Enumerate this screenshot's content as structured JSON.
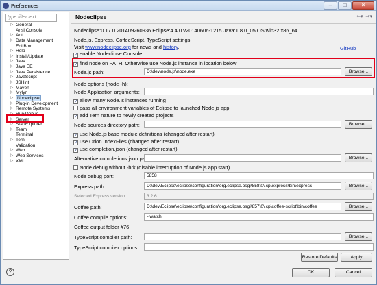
{
  "window": {
    "title": "Preferences"
  },
  "filter": {
    "placeholder": "type filter text"
  },
  "tree": [
    {
      "label": "General",
      "arrow": true
    },
    {
      "label": "Ansi Console",
      "arrow": false
    },
    {
      "label": "Ant",
      "arrow": true
    },
    {
      "label": "Data Management",
      "arrow": true
    },
    {
      "label": "EditBox",
      "arrow": false
    },
    {
      "label": "Help",
      "arrow": true
    },
    {
      "label": "Install/Update",
      "arrow": true
    },
    {
      "label": "Java",
      "arrow": true
    },
    {
      "label": "Java EE",
      "arrow": true
    },
    {
      "label": "Java Persistence",
      "arrow": true
    },
    {
      "label": "JavaScript",
      "arrow": true
    },
    {
      "label": "JSHint",
      "arrow": true
    },
    {
      "label": "Maven",
      "arrow": true
    },
    {
      "label": "Mylyn",
      "arrow": true
    },
    {
      "label": "Nodeclipse",
      "arrow": true,
      "selected": true
    },
    {
      "label": "Plug-in Development",
      "arrow": true
    },
    {
      "label": "Remote Systems",
      "arrow": true
    },
    {
      "label": "Run/Debug",
      "arrow": true
    },
    {
      "label": "Server",
      "arrow": true
    },
    {
      "label": "StartExplorer",
      "arrow": true
    },
    {
      "label": "Team",
      "arrow": true
    },
    {
      "label": "Terminal",
      "arrow": false
    },
    {
      "label": "Tern",
      "arrow": true
    },
    {
      "label": "Validation",
      "arrow": false
    },
    {
      "label": "Web",
      "arrow": true
    },
    {
      "label": "Web Services",
      "arrow": true
    },
    {
      "label": "XML",
      "arrow": true
    }
  ],
  "page": {
    "title": "Nodeclipse",
    "version_line": "Nodeclipse:0.17.0.201409260936 Eclipse:4.4.0.v20140606-1215 Java:1.8.0_05 OS:win32,x86_64",
    "settings_heading": "Node.js, Express, CoffeeScript, TypeScript settings",
    "visit_prefix": "Visit",
    "visit_link": "www.nodeclipse.org",
    "visit_mid": "for news",
    "visit_and": "and",
    "history_link": "history",
    "visit_suffix": ".",
    "github_link": "GitHub",
    "enable_console": "enable Nodeclipse Console",
    "find_node": "find node on PATH. Otherwise use Node.js instance in location below",
    "node_path_label": "Node.js path:",
    "node_path_value": "D:\\dev\\node.js\\node.exe",
    "node_options_label": "Node options (node -h):",
    "node_app_args_label": "Node Application arguments:",
    "allow_many": "allow many Node.js instances running",
    "pass_env": "pass all environment variables of Eclipse to launched Node.js app",
    "add_tern": "add Tern nature to newly created projects",
    "node_sources_label": "Node sources directory path:",
    "use_base_defs": "use Node.js base module definitions (changed after restart)",
    "use_orion": "use Orion IndexFiles (changed after restart)",
    "use_completion": "use completion.json (changed after restart)",
    "alt_completions_label": "Alternative completions.json path:",
    "node_debug_nobrk": "Node debug without -brk (disable interruption of Node.js app start)",
    "debug_port_label": "Node debug port:",
    "debug_port_value": "5858",
    "express_path_label": "Express path:",
    "express_path_value": "D:\\dev\\Eclipse\\eclipse\\configuration\\org.eclipse.osgi\\858\\0\\.cp\\express\\bin\\express",
    "express_version_label": "Selected Express version",
    "express_version_value": "3.2.6",
    "coffee_path_label": "Coffee path:",
    "coffee_path_value": "D:\\dev\\Eclipse\\eclipse\\configuration\\org.eclipse.osgi\\857\\0\\.cp\\coffee-script\\bin\\coffee",
    "coffee_options_label": "Coffee compile options:",
    "coffee_options_value": "--watch",
    "coffee_output_label": "Coffee output folder #76",
    "ts_path_label": "TypeScript compiler path:",
    "ts_options_label": "TypeScript compiler options:",
    "browse": "Browse...",
    "restore_defaults": "Restore Defaults",
    "apply": "Apply"
  },
  "footer": {
    "ok": "OK",
    "cancel": "Cancel"
  },
  "colors": {
    "highlight": "#e2001a",
    "link": "#1a3ec2"
  }
}
